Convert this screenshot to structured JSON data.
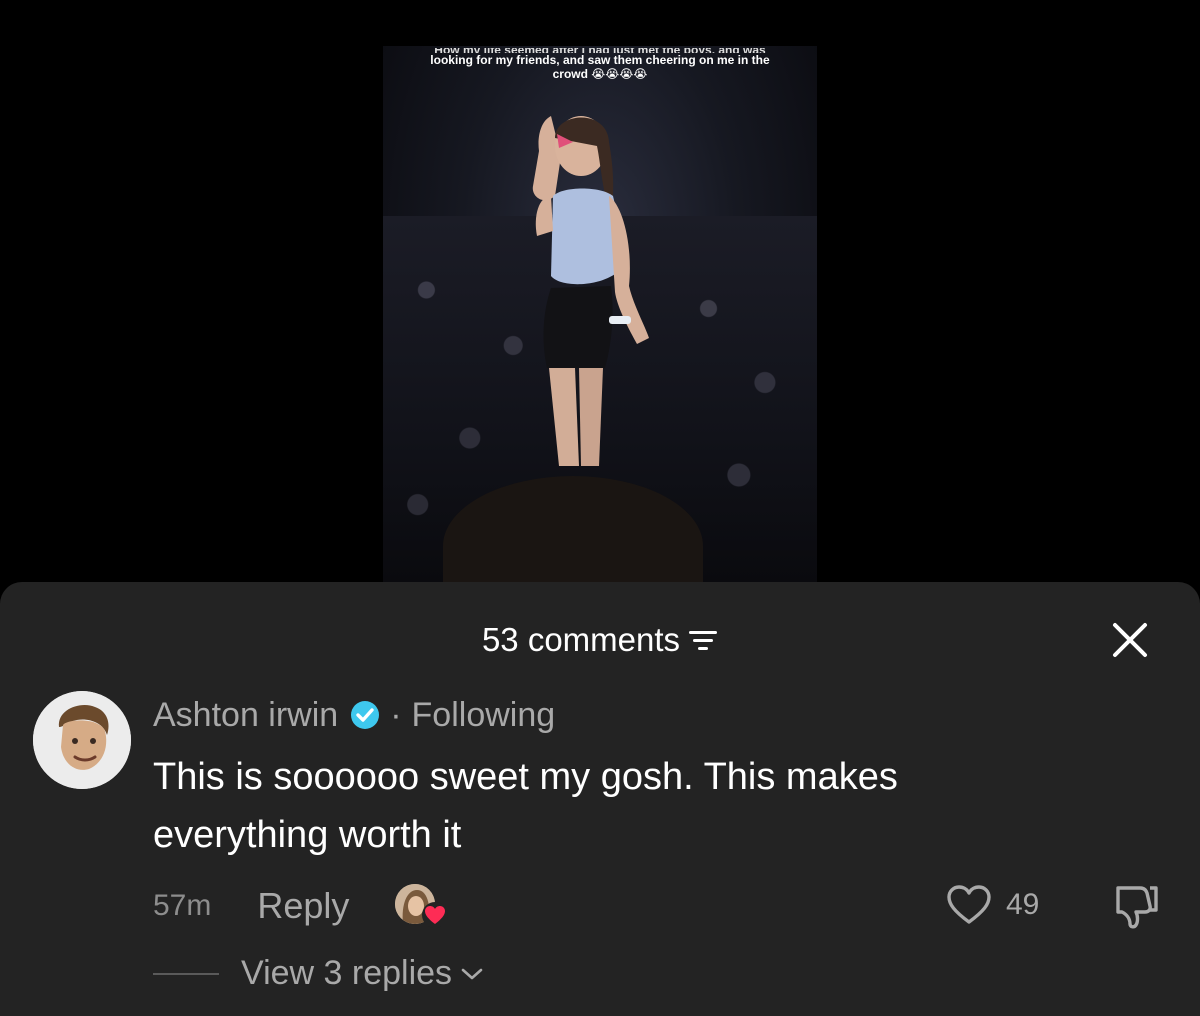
{
  "video": {
    "caption_partial": "How my life seemed after I had just met the boys, and was",
    "caption_line2": "looking for my friends, and saw them cheering on me in the",
    "caption_line3": "crowd 😭😭😭😭"
  },
  "sheet": {
    "comments_label": "53 comments",
    "close_icon": "close-icon",
    "filter_icon": "filter-icon"
  },
  "comment": {
    "author": "Ashton irwin",
    "separator": "·",
    "relation": "Following",
    "text": "This is soooooo sweet my gosh. This makes everything worth it",
    "timestamp": "57m",
    "reply_label": "Reply",
    "like_count": "49",
    "view_replies_label": "View 3 replies",
    "verified_color": "#3ec8ee",
    "heart_color": "#fe2c55"
  }
}
